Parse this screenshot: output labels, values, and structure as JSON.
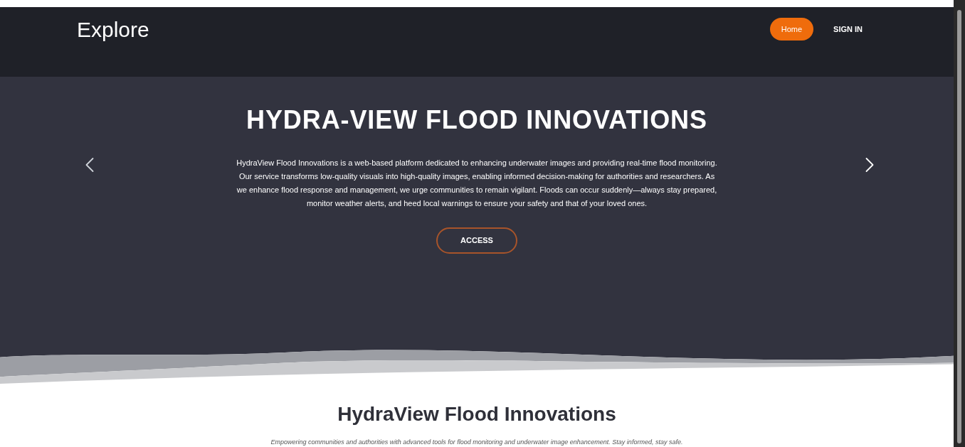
{
  "navbar": {
    "brand": "Explore",
    "links": [
      {
        "label": "Home",
        "selected": true
      },
      {
        "label": "SIGN IN",
        "selected": false
      }
    ]
  },
  "hero": {
    "title": "HYDRA-VIEW FLOOD INNOVATIONS",
    "description": "HydraView Flood Innovations is a web-based platform dedicated to enhancing underwater images and providing real-time flood monitoring. Our service transforms low-quality visuals into high-quality images, enabling informed decision-making for authorities and researchers. As we enhance flood response and management, we urge communities to remain vigilant. Floods can occur suddenly—always stay prepared, monitor weather alerts, and heed local warnings to ensure your safety and that of your loved ones.",
    "button": "ACCESS"
  },
  "section": {
    "title": "HydraView Flood Innovations",
    "subtitle": "Empowering communities and authorities with advanced tools for flood monitoring and underwater image enhancement. Stay informed, stay safe."
  }
}
